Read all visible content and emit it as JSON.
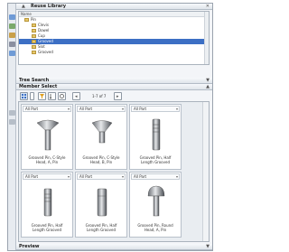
{
  "panel": {
    "title": "Reuse Library",
    "collapse_icon": "chevron-up-icon"
  },
  "tree": {
    "column_header": "Name",
    "items": [
      {
        "label": "Pin",
        "indent": 0,
        "selected": false
      },
      {
        "label": "Clevis",
        "indent": 1,
        "selected": false
      },
      {
        "label": "Dowel",
        "indent": 1,
        "selected": false
      },
      {
        "label": "Cup",
        "indent": 1,
        "selected": false
      },
      {
        "label": "Grooved",
        "indent": 1,
        "selected": true
      },
      {
        "label": "Slot",
        "indent": 1,
        "selected": false
      },
      {
        "label": "Grooved",
        "indent": 1,
        "selected": false
      }
    ]
  },
  "sections": {
    "tree_search": "Tree Search",
    "member_select": "Member Select",
    "preview": "Preview"
  },
  "toolbar": {
    "counter": "1-7 of 7",
    "buttons": [
      "view-mode-button",
      "filter-button",
      "sort-button",
      "refresh-button"
    ]
  },
  "cards": [
    {
      "dropdown": "All Part",
      "caption_1": "Grooved Pin, C-Style",
      "caption_2": "Head, A, Pin",
      "shape": "cone-head"
    },
    {
      "dropdown": "All Part",
      "caption_1": "Grooved Pin, C-Style",
      "caption_2": "Head, B, Pin",
      "shape": "cone-head-short"
    },
    {
      "dropdown": "All Part",
      "caption_1": "Grooved Pin, Half",
      "caption_2": "Length Grooved",
      "shape": "cylinder-groove"
    },
    {
      "dropdown": "All Part",
      "caption_1": "Grooved Pin, Half",
      "caption_2": "Length Grooved",
      "shape": "cylinder-groove"
    },
    {
      "dropdown": "All Part",
      "caption_1": "Grooved Pin, Half",
      "caption_2": "Length Grooved",
      "shape": "cylinder-plain"
    },
    {
      "dropdown": "All Part",
      "caption_1": "Grooved Pin, Round",
      "caption_2": "Head, A, Pin",
      "shape": "round-head"
    }
  ],
  "colors": {
    "selection": "#3c6fc4",
    "header_bg": "#dfe4ea"
  }
}
